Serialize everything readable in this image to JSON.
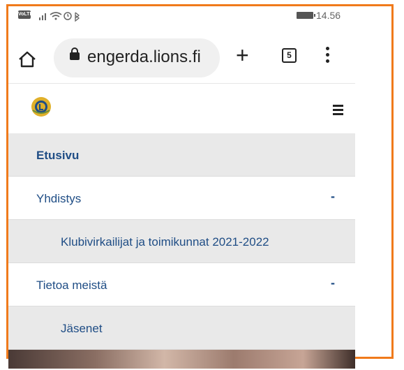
{
  "status_bar": {
    "volte": "VoLTE",
    "time": "14.56"
  },
  "browser": {
    "url": "engerda.lions.fi",
    "tab_count": "5"
  },
  "nav": [
    {
      "label": "Etusivu",
      "bold": true
    },
    {
      "label": "Yhdistys",
      "toggle": "-"
    },
    {
      "label": "Klubivirkailijat ja toimikunnat 2021-2022"
    },
    {
      "label": "Tietoa meistä",
      "toggle": "-"
    },
    {
      "label": "Jäsenet"
    }
  ],
  "colors": {
    "frame": "#f07a1b",
    "nav_text": "#1f4d85"
  },
  "icons": [
    "home-icon",
    "lock-icon",
    "new-tab-icon",
    "tabs-icon",
    "menu-icon",
    "hamburger-icon",
    "lions-logo"
  ]
}
